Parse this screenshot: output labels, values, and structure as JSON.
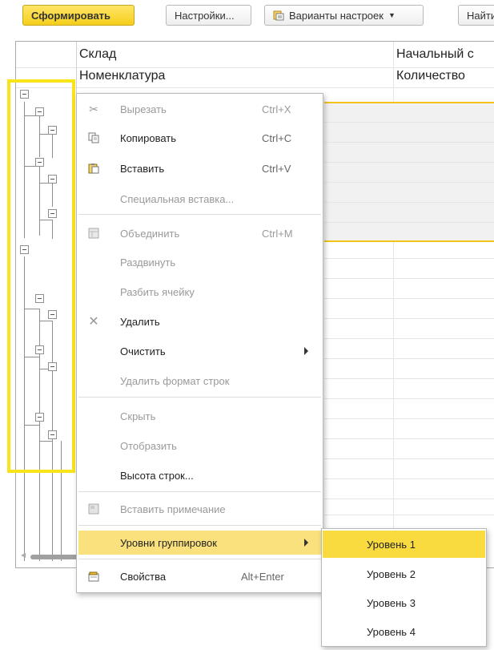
{
  "toolbar": {
    "generate_label": "Сформировать",
    "settings_label": "Настройки...",
    "variants_label": "Варианты настроек",
    "find_label": "Найти"
  },
  "sheet": {
    "col1_header1": "Склад",
    "col1_header2": "Номенклатура",
    "col2_header1": "Начальный с",
    "col2_header2": "Количество"
  },
  "context_menu": {
    "items": [
      {
        "label": "Вырезать",
        "shortcut": "Ctrl+X",
        "icon": "scissors-icon",
        "enabled": false
      },
      {
        "label": "Копировать",
        "shortcut": "Ctrl+C",
        "icon": "copy-icon",
        "enabled": true
      },
      {
        "label": "Вставить",
        "shortcut": "Ctrl+V",
        "icon": "paste-icon",
        "enabled": true
      },
      {
        "label": "Специальная вставка...",
        "shortcut": "",
        "enabled": false
      },
      {
        "label": "Объединить",
        "shortcut": "Ctrl+M",
        "icon": "merge-cells-icon",
        "enabled": false
      },
      {
        "label": "Раздвинуть",
        "shortcut": "",
        "enabled": false
      },
      {
        "label": "Разбить ячейку",
        "shortcut": "",
        "enabled": false
      },
      {
        "label": "Удалить",
        "shortcut": "",
        "icon": "delete-x-icon",
        "enabled": true
      },
      {
        "label": "Очистить",
        "shortcut": "",
        "enabled": true,
        "submenu": true
      },
      {
        "label": "Удалить формат строк",
        "shortcut": "",
        "enabled": false
      },
      {
        "label": "Скрыть",
        "shortcut": "",
        "enabled": false
      },
      {
        "label": "Отобразить",
        "shortcut": "",
        "enabled": false
      },
      {
        "label": "Высота строк...",
        "shortcut": "",
        "enabled": true
      },
      {
        "label": "Вставить примечание",
        "shortcut": "",
        "icon": "note-icon",
        "enabled": false
      },
      {
        "label": "Уровни группировок",
        "shortcut": "",
        "enabled": true,
        "submenu": true,
        "highlighted": true
      },
      {
        "label": "Свойства",
        "shortcut": "Alt+Enter",
        "icon": "properties-icon",
        "enabled": true
      }
    ]
  },
  "submenu": {
    "items": [
      "Уровень 1",
      "Уровень 2",
      "Уровень 3",
      "Уровень 4"
    ],
    "highlighted_index": 0
  },
  "colors": {
    "accent": "#f5cf1c",
    "highlight": "#f9da3f",
    "outline_box": "#f7e51a"
  }
}
